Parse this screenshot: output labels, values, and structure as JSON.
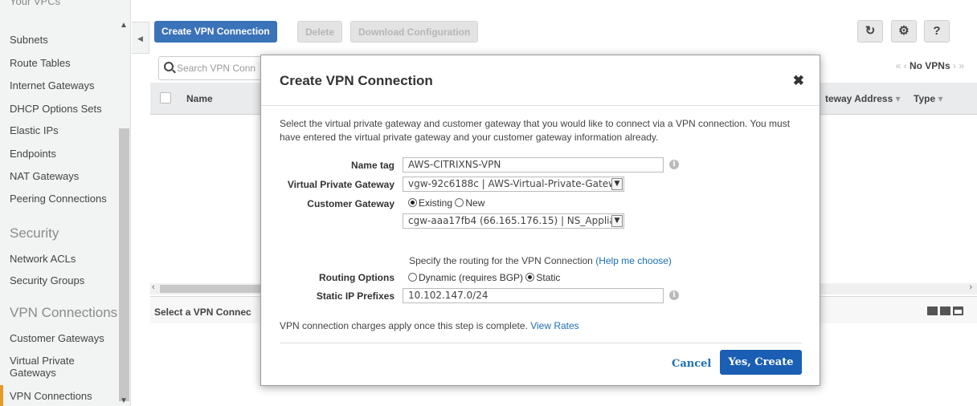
{
  "sidebar": {
    "cut_item": "Your VPCs",
    "items": [
      {
        "label": "Subnets"
      },
      {
        "label": "Route Tables"
      },
      {
        "label": "Internet Gateways"
      },
      {
        "label": "DHCP Options Sets"
      },
      {
        "label": "Elastic IPs"
      },
      {
        "label": "Endpoints"
      },
      {
        "label": "NAT Gateways"
      },
      {
        "label": "Peering Connections"
      }
    ],
    "security_section": "Security",
    "security_items": [
      {
        "label": "Network ACLs"
      },
      {
        "label": "Security Groups"
      }
    ],
    "vpn_section": "VPN Connections",
    "vpn_items": [
      {
        "label": "Customer Gateways"
      },
      {
        "label": "Virtual Private Gateways"
      },
      {
        "label": "VPN Connections"
      }
    ]
  },
  "toolbar": {
    "create_label": "Create VPN Connection",
    "delete_label": "Delete",
    "download_label": "Download Configuration",
    "icons": [
      "refresh-icon",
      "gear-icon",
      "help-icon"
    ]
  },
  "grid": {
    "search_placeholder": "Search VPN Conn",
    "pager_text": "No VPNs",
    "columns": {
      "name": "Name",
      "gateway": "teway Address",
      "type": "Type"
    }
  },
  "detail": {
    "label": "Select a VPN Connec"
  },
  "modal": {
    "title": "Create VPN Connection",
    "intro": "Select the virtual private gateway and customer gateway that you would like to connect via a VPN connection. You must have entered the virtual private gateway and your customer gateway information already.",
    "name_tag_label": "Name tag",
    "name_tag_value": "AWS-CITRIXNS-VPN",
    "vpg_label": "Virtual Private Gateway",
    "vpg_value": "vgw-92c6188c | AWS-Virtual-Private-Gatew",
    "cgw_label": "Customer Gateway",
    "cgw_existing": "Existing",
    "cgw_new": "New",
    "cgw_value": "cgw-aaa17fb4 (66.165.176.15) | NS_Applia",
    "routing_text": "Specify the routing for the VPN Connection",
    "routing_help": "(Help me choose)",
    "routing_label": "Routing Options",
    "routing_dynamic": "Dynamic (requires BGP)",
    "routing_static": "Static",
    "prefix_label": "Static IP Prefixes",
    "prefix_value": "10.102.147.0/24",
    "charges_text": "VPN connection charges apply once this step is complete.",
    "view_rates": "View Rates",
    "cancel_label": "Cancel",
    "create_label": "Yes, Create"
  }
}
